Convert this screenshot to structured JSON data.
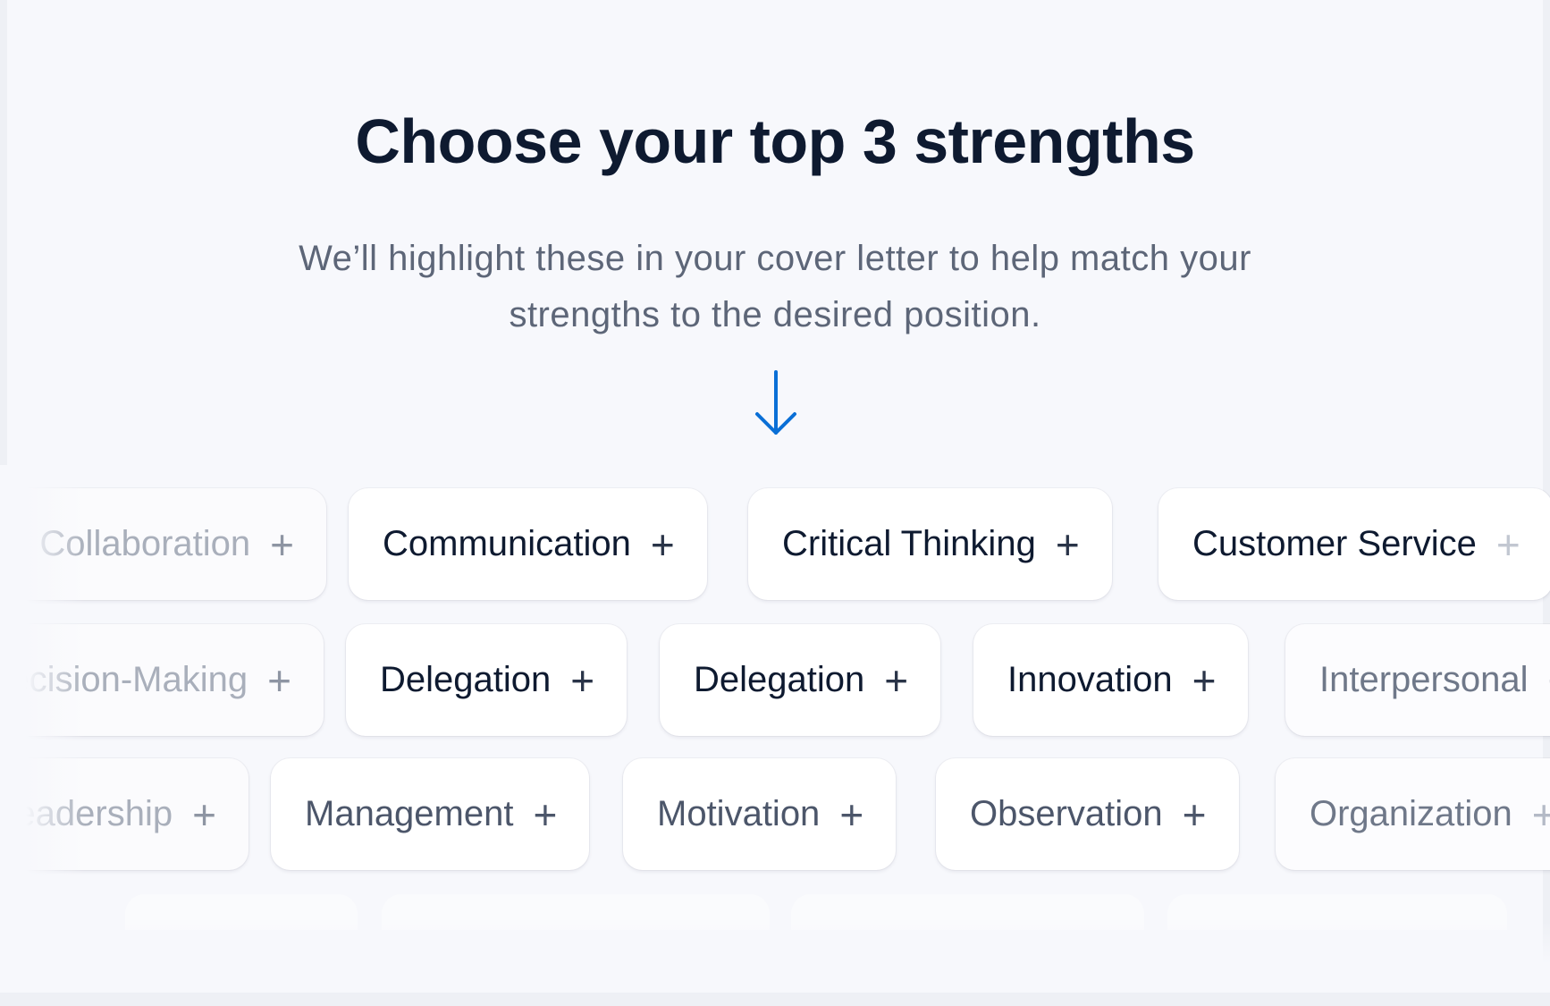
{
  "header": {
    "title": "Choose your top 3 strengths",
    "subtitle_line1": "We’ll highlight these in your cover letter to help match your",
    "subtitle_line2": "strengths to the desired position.",
    "arrow_icon": "arrow-down-icon",
    "accent_color": "#0a6fd6"
  },
  "strengths": {
    "add_icon": "+",
    "row1": [
      "Collaboration",
      "Communication",
      "Critical Thinking",
      "Customer Service"
    ],
    "row2": [
      "Decision-Making",
      "Delegation",
      "Delegation",
      "Innovation",
      "Interpersonal"
    ],
    "row3": [
      "Leadership",
      "Management",
      "Motivation",
      "Observation",
      "Organization"
    ]
  }
}
